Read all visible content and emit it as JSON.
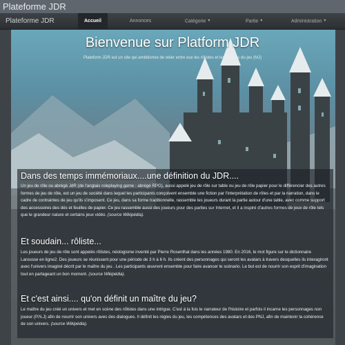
{
  "window_title": "Plateforme JDR",
  "nav": {
    "brand": "Plateforme JDR",
    "items": [
      {
        "label": "Accueil",
        "active": true,
        "dropdown": false
      },
      {
        "label": "Annonces",
        "active": false,
        "dropdown": false
      },
      {
        "label": "Catégorie",
        "active": false,
        "dropdown": true
      },
      {
        "label": "Partie",
        "active": false,
        "dropdown": true
      },
      {
        "label": "Administration",
        "active": false,
        "dropdown": true
      }
    ]
  },
  "hero": {
    "title": "Bienvenue sur Platform JDR",
    "subtitle": "Plateform JDR est un site qui ambitionne de relier entre eux les rôlistes et les maîtres du jeu (MJ)"
  },
  "sections": [
    {
      "title": "Dans des temps immémoriaux....une définition du JDR....",
      "text": "Un jeu de rôle ou abrégé JdR (de l'anglais roleplaying game : abrégé RPG), aussi appelé jeu de rôle sur table ou jeu de rôle papier pour le différencier des autres formes de jeu de rôle, est un jeu de société dans lequel les participants conçoivent ensemble une fiction par l'interprétation de rôles et par la narration, dans le cadre de contraintes de jeu qu'ils s'imposent. Ce jeu, dans sa forme traditionnelle, rassemble les joueurs durant la partie autour d'une table, avec comme support des accessoires des dés et feuilles de papier. Ce jeu rassemble aussi des joueurs pour des parties sur Internet, et il a inspiré d'autres formes de jeux de rôle tels que le grandeur nature et certains jeux vidéo.",
      "source": "(source Wikipédia)."
    },
    {
      "title": "Et soudain... rôliste...",
      "text": "Les joueurs de jeu de rôle sont appelés rôlistes, néologisme inventé par Pierre Rosenthal dans les années 1980. En 2016, le mot figure sur le dictionnaire Larousse en ligne2. Des joueurs se réunissent pour une période de 3 h à 6 h. Ils créent des personnages qui seront les avatars à travers desquelles ils interagiront avec l'univers imaginé décrit par le maître du jeu . Les participants œuvrent ensemble pour faire avancer le scénario. Le but est de nourrir son esprit d'imagination tout en partageant un bon moment.",
      "source": "(source Wikipédia)."
    },
    {
      "title": "Et c'est ainsi.... qu'on définit un maître du jeu?",
      "text": "Le maître du jeu créé un univers et met en scène des rôlistes dans une intrigue. C'est à la fois le narrateur de l'histoire et parfois il incarne les personnages non joueur (P.N.J) afin de nourrir son univers avec des dialogues. Il définit les règles du jeu, les compétences des avatars et des PNJ, afin de maintenir la cohérence de son univers.",
      "source": "(source Wikipédia)."
    }
  ]
}
